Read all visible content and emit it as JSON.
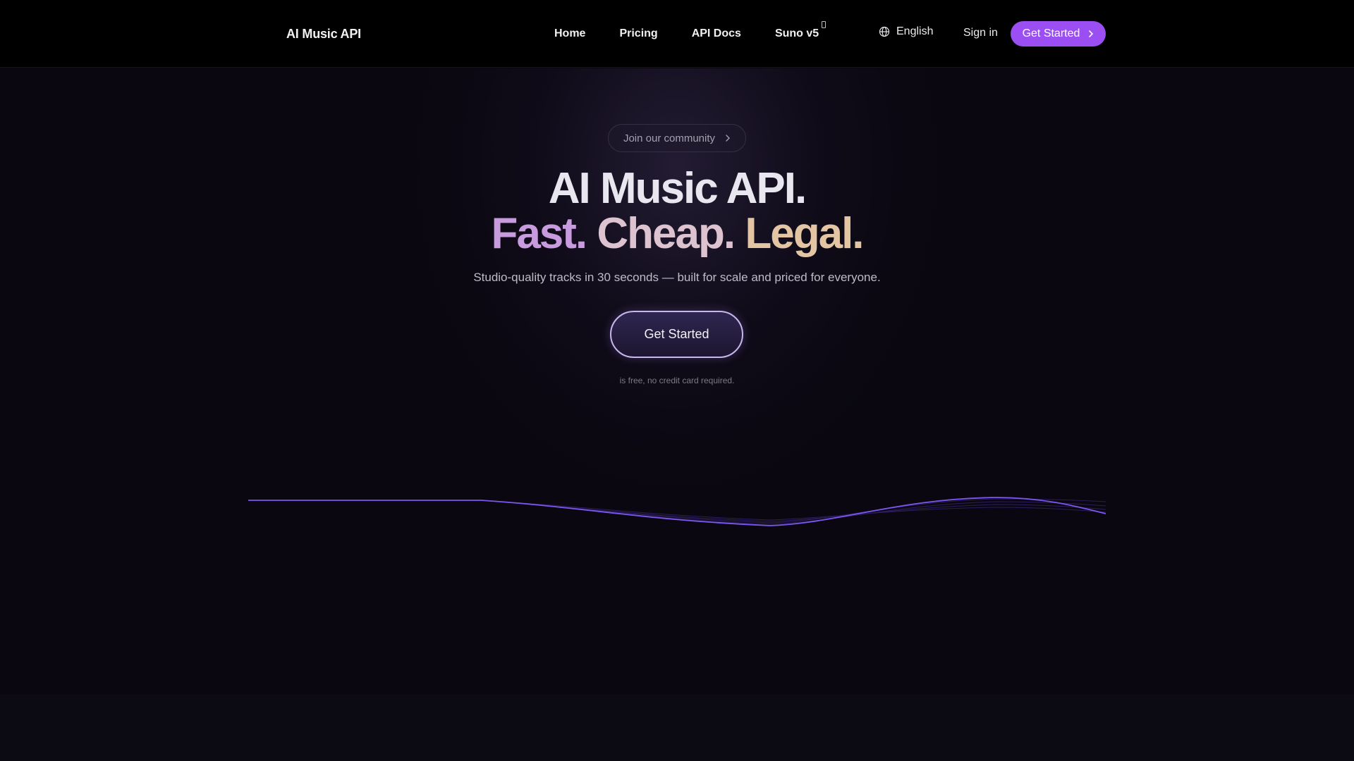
{
  "header": {
    "logo_text": "AI Music API",
    "nav": [
      {
        "label": "Home"
      },
      {
        "label": "Pricing"
      },
      {
        "label": "API Docs"
      },
      {
        "label": "Suno v5"
      }
    ],
    "language": "English",
    "signin": "Sign in",
    "cta": "Get Started"
  },
  "hero": {
    "community": "Join our community",
    "title_line1": "AI Music API.",
    "title_fast": "Fast.",
    "title_cheap": "Cheap.",
    "title_legal": "Legal.",
    "subtitle": "Studio-quality tracks in 30 seconds — built for scale and priced for everyone.",
    "cta": "Get Started",
    "note": "is free, no credit card required."
  },
  "colors": {
    "accent": "#9b4ff2",
    "fast": "#c89bdf",
    "cheap": "#ddc2cf",
    "legal": "#e3c5a4",
    "wave": "#6b46e8"
  },
  "icons": {
    "logo": "waveform-logo-icon",
    "language": "globe-icon",
    "arrow": "chevron-right-icon",
    "badge": "external-link-icon"
  }
}
